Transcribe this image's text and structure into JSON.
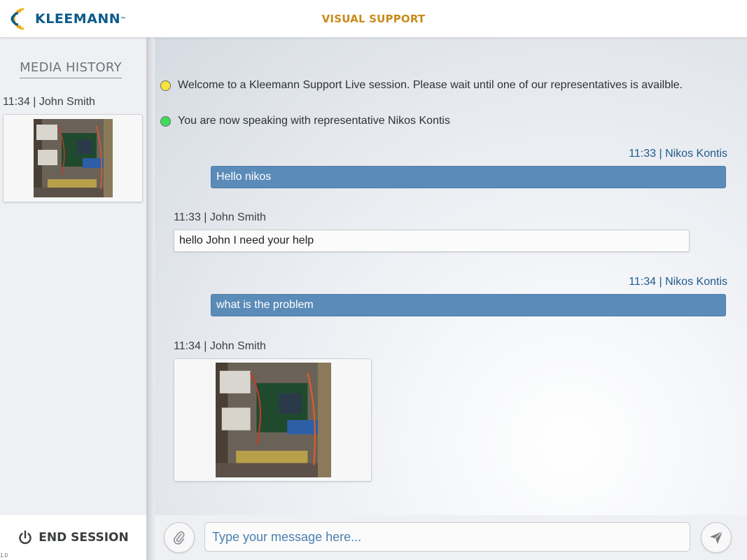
{
  "header": {
    "brand": "KLEEMANN",
    "trademark": "™",
    "title": "VISUAL SUPPORT"
  },
  "sidebar": {
    "title": "MEDIA HISTORY",
    "items": [
      {
        "meta": "11:34 | John Smith",
        "type": "image"
      }
    ]
  },
  "chat": {
    "system_messages": [
      {
        "text": "Welcome to a Kleemann Support Live session. Please wait until one of our representatives is availble.",
        "status": "yellow"
      },
      {
        "text": "You are now speaking with representative Nikos Kontis",
        "status": "green"
      }
    ],
    "messages": [
      {
        "meta": "11:33 | Nikos Kontis",
        "text": "Hello nikos",
        "from": "agent"
      },
      {
        "meta": "11:33 | John Smith",
        "text": "hello John I need your help",
        "from": "user"
      },
      {
        "meta": "11:34 | Nikos Kontis",
        "text": "what is the problem",
        "from": "agent"
      },
      {
        "meta": "11:34 | John Smith",
        "type": "image",
        "from": "user"
      }
    ]
  },
  "footer": {
    "end_session_label": "END SESSION",
    "version": "1.0",
    "message_placeholder": "Type your message here...",
    "attach_icon": "paperclip-icon",
    "send_icon": "paper-plane-icon"
  },
  "colors": {
    "brand_blue": "#0d5b8a",
    "title_gold": "#c98a1a",
    "agent_bubble": "#5b8bb8",
    "agent_meta": "#1e5a8a"
  }
}
